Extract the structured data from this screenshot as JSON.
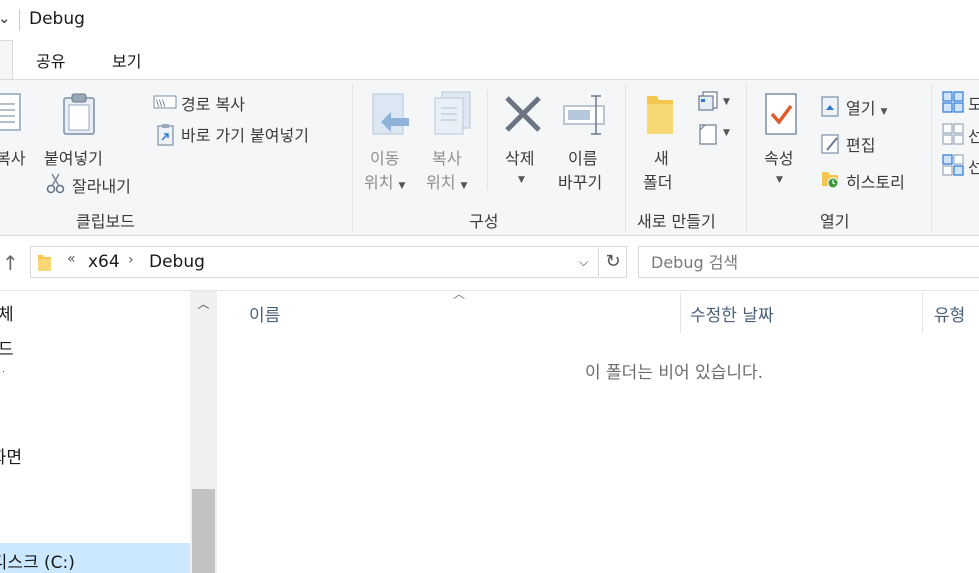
{
  "window": {
    "title": "Debug",
    "title_glyph": "⌄"
  },
  "tabs": [
    {
      "label": "공유"
    },
    {
      "label": "보기"
    }
  ],
  "ribbon": {
    "clipboard": {
      "group_label": "클립보드",
      "copy_label_partial": "복사",
      "paste_label": "붙여넣기",
      "copy_path_label": "경로 복사",
      "paste_shortcut_label": "바로 가기 붙여넣기",
      "cut_label": "잘라내기"
    },
    "organize": {
      "group_label": "구성",
      "move_to_line1": "이동",
      "move_to_line2": "위치",
      "copy_to_line1": "복사",
      "copy_to_line2": "위치",
      "delete_label": "삭제",
      "rename_line1": "이름",
      "rename_line2": "바꾸기"
    },
    "new": {
      "group_label": "새로 만들기",
      "new_folder_line1": "새",
      "new_folder_line2": "폴더"
    },
    "open": {
      "group_label": "열기",
      "properties_label": "속성",
      "open_label": "열기",
      "edit_label": "편집",
      "history_label": "히스토리"
    },
    "select": {
      "partial1": "모",
      "partial2": "선",
      "partial3": "선"
    }
  },
  "address": {
    "overflow": "«",
    "segments": [
      "x64",
      "Debug"
    ],
    "search_placeholder": "Debug 검색"
  },
  "navpane": {
    "items": [
      {
        "label": "체"
      },
      {
        "label": "드"
      },
      {
        "label": "ᆞ"
      },
      {
        "label": "바탕 화면"
      },
      {
        "label": "로컬 디스크 (C:)"
      }
    ]
  },
  "content": {
    "columns": [
      "이름",
      "수정한 날짜",
      "유형"
    ],
    "empty_message": "이 폴더는 비어 있습니다."
  },
  "colors": {
    "accent_blue": "#2b79d9",
    "folder_yellow": "#f3c74f",
    "delete_gray": "#6b7480",
    "ribbon_bg": "#f5f6f7"
  }
}
